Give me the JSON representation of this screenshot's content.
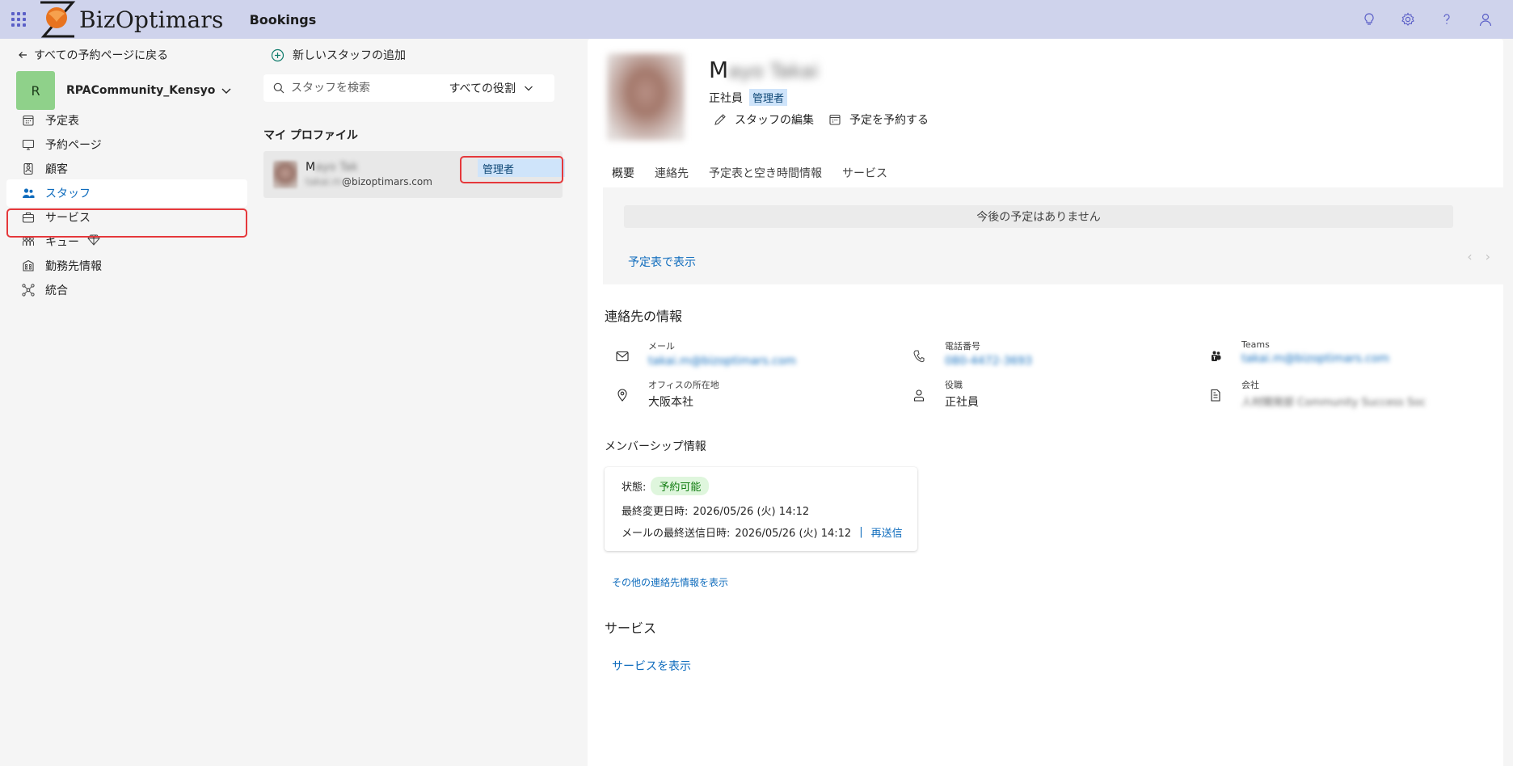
{
  "header": {
    "brand": "BizOptimars",
    "app_name": "Bookings",
    "icons": [
      "waffle-icon",
      "lightbulb-icon",
      "gear-icon",
      "help-icon",
      "person-icon"
    ]
  },
  "nav": {
    "back_label": "すべての予約ページに戻る",
    "business": {
      "initial": "R",
      "name": "RPACommunity_Kensyo"
    },
    "items": [
      {
        "label": "予定表",
        "icon": "calendar-icon"
      },
      {
        "label": "予約ページ",
        "icon": "monitor-icon"
      },
      {
        "label": "顧客",
        "icon": "contact-card-icon"
      },
      {
        "label": "スタッフ",
        "icon": "people-icon"
      },
      {
        "label": "サービス",
        "icon": "briefcase-icon"
      },
      {
        "label": "キュー",
        "icon": "queue-icon"
      },
      {
        "label": "勤務先情報",
        "icon": "building-icon"
      },
      {
        "label": "統合",
        "icon": "integration-icon"
      }
    ],
    "active_index": 3
  },
  "staff_list": {
    "add_label": "新しいスタッフの追加",
    "search_placeholder": "スタッフを検索",
    "role_filter": "すべての役割",
    "section": "マイ プロファイル",
    "me": {
      "initial": "M",
      "name_rest": "ayo Tak",
      "email_prefix": "takai.m",
      "email_domain": "@bizoptimars.com",
      "role": "管理者"
    }
  },
  "profile": {
    "initial": "M",
    "name_rest": "ayo Takai",
    "employment": "正社員",
    "role_badge": "管理者",
    "actions": {
      "edit": "スタッフの編集",
      "book": "予定を予約する"
    },
    "tabs": [
      "概要",
      "連絡先",
      "予定表と空き時間情報",
      "サービス"
    ],
    "active_tab": 0,
    "no_appointments": "今後の予定はありません",
    "calendar_link": "予定表で表示",
    "contact": {
      "heading": "連絡先の情報",
      "email": {
        "label": "メール",
        "value": "takai.m@bizoptimars.com"
      },
      "phone": {
        "label": "電話番号",
        "value": "080-4472-3693"
      },
      "teams": {
        "label": "Teams",
        "value": "takai.m@bizoptimars.com"
      },
      "office": {
        "label": "オフィスの所在地",
        "value": "大阪本社"
      },
      "title": {
        "label": "役職",
        "value": "正社員"
      },
      "company": {
        "label": "会社",
        "value": "人材開発部 Community Success Soc"
      }
    },
    "membership": {
      "heading": "メンバーシップ情報",
      "status_label": "状態:",
      "status_value": "予約可能",
      "modified_label": "最終変更日時:",
      "modified_value": "2026/05/26 (火) 14:12",
      "sent_label": "メールの最終送信日時:",
      "sent_value": "2026/05/26 (火) 14:12",
      "separator": "|",
      "resend": "再送信"
    },
    "more_contact": "その他の連絡先情報を表示",
    "services_heading": "サービス",
    "services_link": "サービスを表示"
  }
}
